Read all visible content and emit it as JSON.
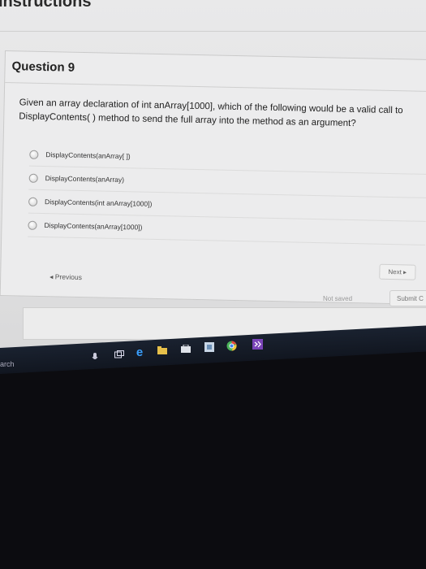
{
  "page": {
    "header_title": "Instructions"
  },
  "question": {
    "title": "Question 9",
    "text_line1": "Given an array declaration of int anArray[1000], which of the following would be a valid call to",
    "text_line2": "DisplayContents( ) method to send the full array into the method as an argument?",
    "options": [
      {
        "label": "DisplayContents(anArray[ ])"
      },
      {
        "label": "DisplayContents(anArray)"
      },
      {
        "label": "DisplayContents(int anArray[1000])"
      },
      {
        "label": "DisplayContents(anArray[1000])"
      }
    ]
  },
  "nav": {
    "next_label": "Next ▸",
    "previous_label": "◂ Previous"
  },
  "footer": {
    "status": "Not saved",
    "submit_label": "Submit C"
  },
  "taskbar": {
    "search_fragment": "arch",
    "icons": [
      "microphone-icon",
      "task-view-icon",
      "edge-icon",
      "store-icon",
      "file-explorer-icon",
      "app-icon",
      "chrome-icon",
      "visual-studio-icon"
    ]
  },
  "colors": {
    "page_bg": "#e9e9ea",
    "card_bg": "#ececed",
    "taskbar_bg": "#1a2230",
    "desk_bg": "#0c0c10"
  }
}
